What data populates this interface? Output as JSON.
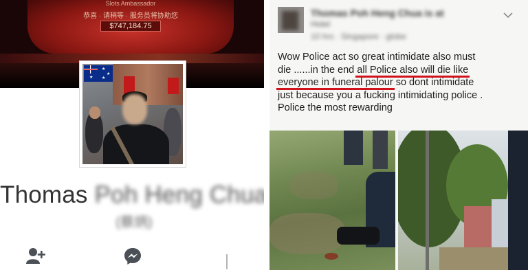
{
  "profile": {
    "cover": {
      "line1": "Slots Ambassador",
      "line2": "恭喜 · 请稍等 · 服务员将协助您",
      "jackpot": "$747,184.75"
    },
    "first_name": "Thomas",
    "last_name_blurred": "Poh Heng Chua",
    "alt_name_blurred": "(蔡炳)",
    "actions": {
      "add_friend": "add-friend-icon",
      "message": "messenger-icon",
      "more": "more-icon"
    }
  },
  "post": {
    "author_blurred": "Thomas Poh Heng Chua is at",
    "author_line2_blurred": "Hotel",
    "meta_blurred": "10 hrs · Singapore · globe",
    "text_lines": [
      "Wow Police act so great intimidate also must",
      "die ......in the end ",
      "all Police also will die like",
      "everyone in funeral palour",
      " so dont intimidate",
      "just because you a fucking intimidating police .",
      "Police the most rewarding"
    ],
    "highlight_color": "#d0121c"
  }
}
